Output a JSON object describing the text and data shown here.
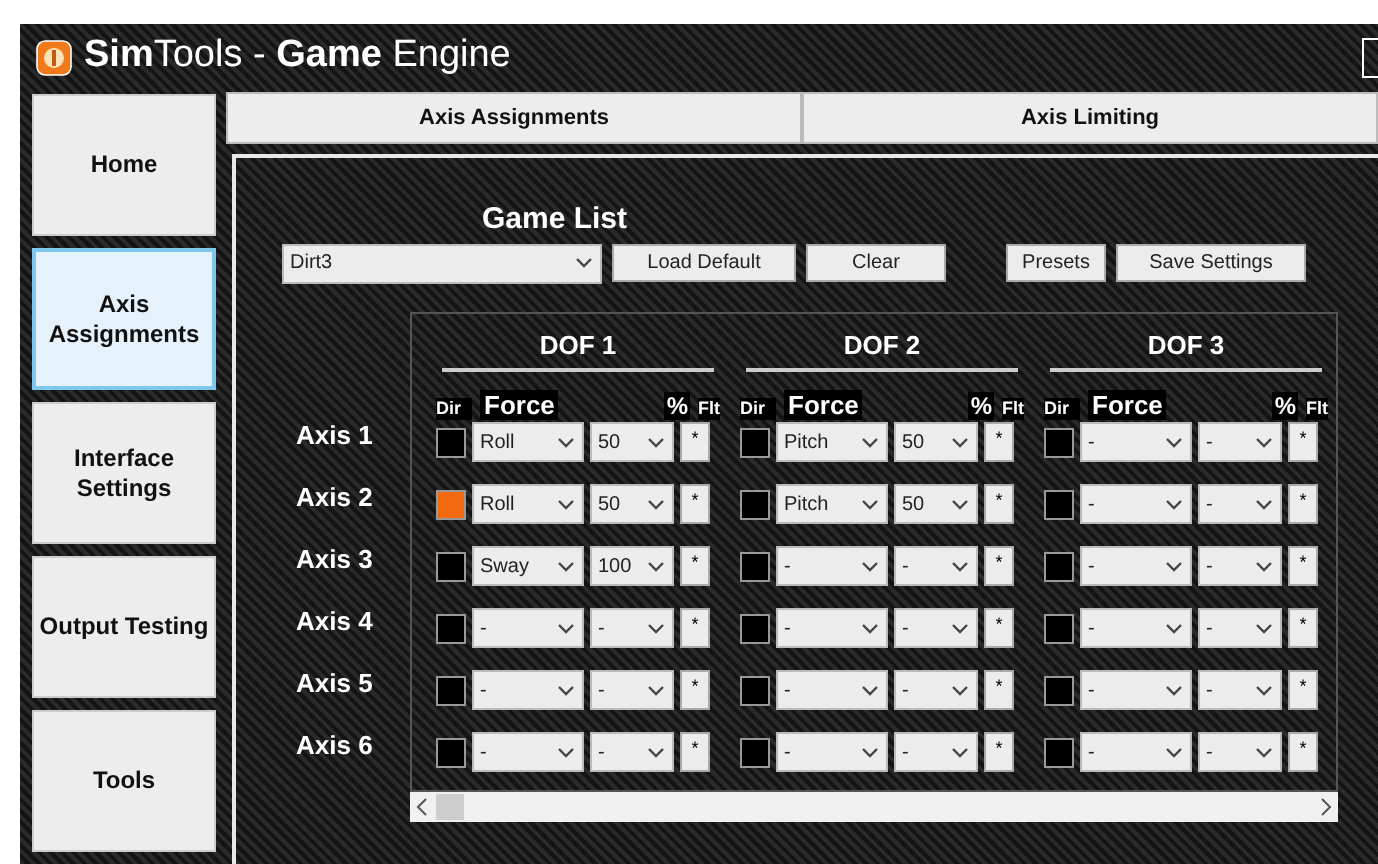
{
  "window": {
    "title": "**Sim**Tools - **Game** Engine"
  },
  "sidebar": {
    "items": [
      {
        "label": "Home",
        "selected": false
      },
      {
        "label": "Axis Assignments",
        "selected": true
      },
      {
        "label": "Interface Settings",
        "selected": false
      },
      {
        "label": "Output Testing",
        "selected": false
      },
      {
        "label": "Tools",
        "selected": false
      }
    ]
  },
  "tabs": [
    {
      "label": "Axis Assignments"
    },
    {
      "label": "Axis Limiting"
    }
  ],
  "game_list": {
    "label": "Game List",
    "value": "Dirt3"
  },
  "buttons": [
    "Load Default",
    "Clear",
    "Presets",
    "Save Settings"
  ],
  "dofs": [
    {
      "title": "DOF 1",
      "columns": [
        "Dir",
        "Force",
        "%",
        "Flt"
      ]
    },
    {
      "title": "DOF 2",
      "columns": [
        "Dir",
        "Force",
        "%",
        "Flt"
      ]
    },
    {
      "title": "DOF 3",
      "columns": [
        "Dir",
        "Force",
        "%",
        "Flt"
      ]
    }
  ],
  "axes": [
    {
      "label": "Axis 1",
      "cells": [
        {
          "dir": false,
          "force": "Roll",
          "percent": "50",
          "flt": "*"
        },
        {
          "dir": false,
          "force": "Pitch",
          "percent": "50",
          "flt": "*"
        },
        {
          "dir": false,
          "force": "-",
          "percent": "-",
          "flt": "*"
        }
      ]
    },
    {
      "label": "Axis 2",
      "cells": [
        {
          "dir": true,
          "force": "Roll",
          "percent": "50",
          "flt": "*"
        },
        {
          "dir": false,
          "force": "Pitch",
          "percent": "50",
          "flt": "*"
        },
        {
          "dir": false,
          "force": "-",
          "percent": "-",
          "flt": "*"
        }
      ]
    },
    {
      "label": "Axis 3",
      "cells": [
        {
          "dir": false,
          "force": "Sway",
          "percent": "100",
          "flt": "*"
        },
        {
          "dir": false,
          "force": "-",
          "percent": "-",
          "flt": "*"
        },
        {
          "dir": false,
          "force": "-",
          "percent": "-",
          "flt": "*"
        }
      ]
    },
    {
      "label": "Axis 4",
      "cells": [
        {
          "dir": false,
          "force": "-",
          "percent": "-",
          "flt": "*"
        },
        {
          "dir": false,
          "force": "-",
          "percent": "-",
          "flt": "*"
        },
        {
          "dir": false,
          "force": "-",
          "percent": "-",
          "flt": "*"
        }
      ]
    },
    {
      "label": "Axis 5",
      "cells": [
        {
          "dir": false,
          "force": "-",
          "percent": "-",
          "flt": "*"
        },
        {
          "dir": false,
          "force": "-",
          "percent": "-",
          "flt": "*"
        },
        {
          "dir": false,
          "force": "-",
          "percent": "-",
          "flt": "*"
        }
      ]
    },
    {
      "label": "Axis 6",
      "cells": [
        {
          "dir": false,
          "force": "-",
          "percent": "-",
          "flt": "*"
        },
        {
          "dir": false,
          "force": "-",
          "percent": "-",
          "flt": "*"
        },
        {
          "dir": false,
          "force": "-",
          "percent": "-",
          "flt": "*"
        }
      ]
    }
  ]
}
